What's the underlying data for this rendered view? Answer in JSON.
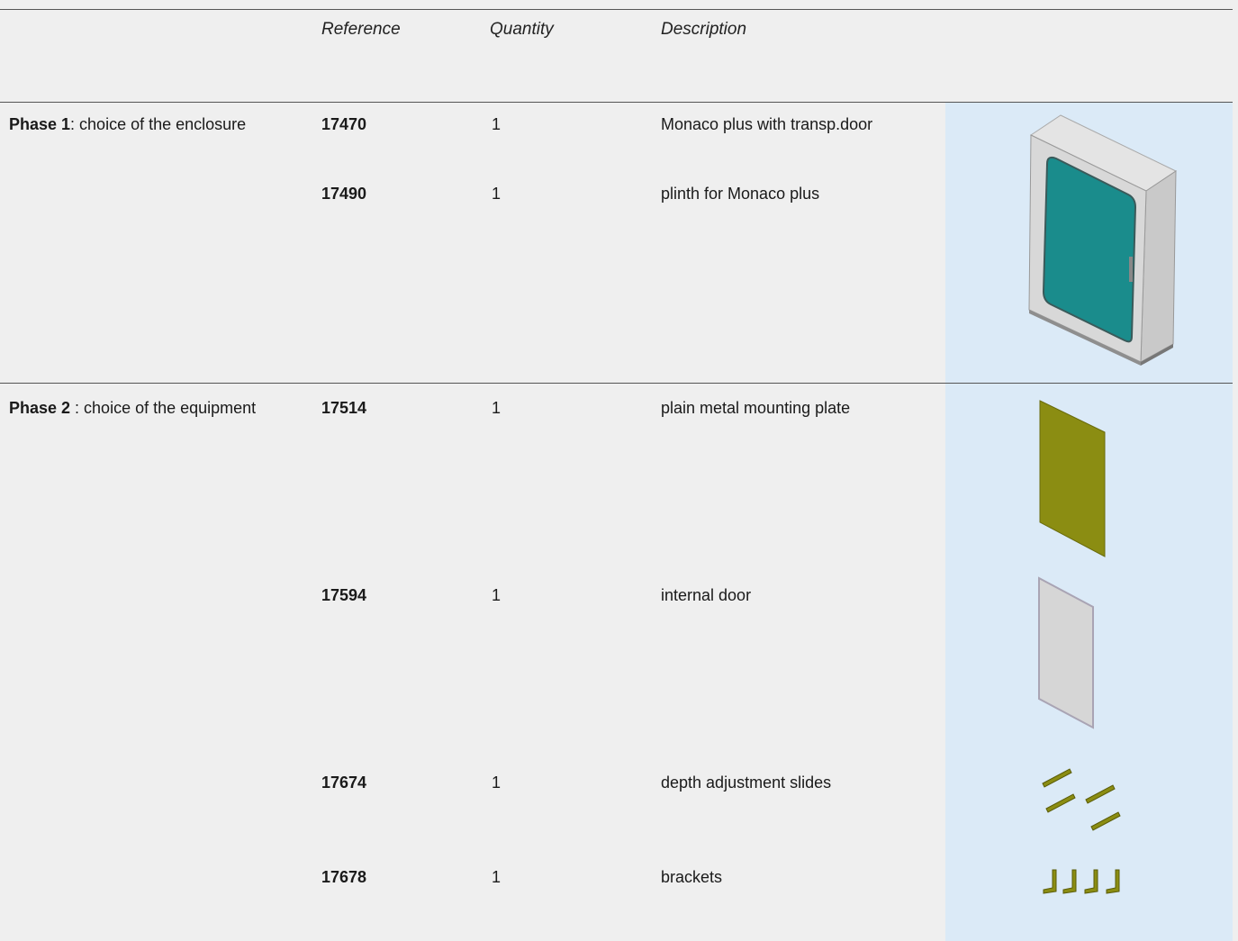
{
  "headers": {
    "reference": "Reference",
    "quantity": "Quantity",
    "description": "Description"
  },
  "phases": [
    {
      "title_bold": "Phase 1",
      "title_rest": ": choice of the enclosure",
      "items": [
        {
          "reference": "17470",
          "quantity": "1",
          "description": "Monaco plus with transp.door",
          "image": "enclosure-cabinet-image"
        },
        {
          "reference": "17490",
          "quantity": "1",
          "description": "plinth for Monaco plus"
        }
      ]
    },
    {
      "title_bold": "Phase 2",
      "title_rest": " : choice of the equipment",
      "items": [
        {
          "reference": "17514",
          "quantity": "1",
          "description": "plain metal mounting plate",
          "image": "mounting-plate-image"
        },
        {
          "reference": "17594",
          "quantity": "1",
          "description": "internal door",
          "image": "internal-door-image"
        },
        {
          "reference": "17674",
          "quantity": "1",
          "description": "depth adjustment slides",
          "image": "slides-image"
        },
        {
          "reference": "17678",
          "quantity": "1",
          "description": "brackets",
          "image": "brackets-image"
        }
      ]
    }
  ],
  "colors": {
    "page_background": "#efefef",
    "image_panel": "#dbeaf7",
    "mounting_plate": "#8b8d12",
    "glass_door": "#1a8c8c"
  }
}
